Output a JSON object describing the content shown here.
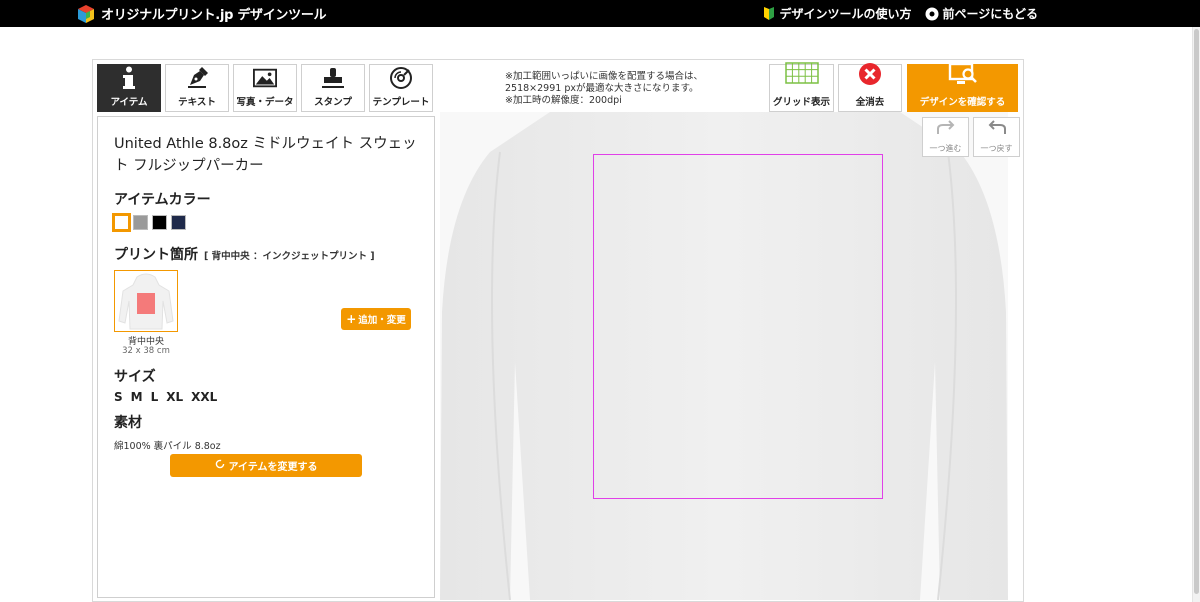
{
  "header": {
    "brand": "オリジナルプリント.jp デザインツール",
    "links": [
      {
        "label": "デザインツールの使い方",
        "icon": "beginner-leaf-icon"
      },
      {
        "label": "前ページにもどる",
        "icon": "back-circle-icon"
      }
    ]
  },
  "tabs": [
    {
      "label": "アイテム",
      "icon": "info-icon",
      "active": true
    },
    {
      "label": "テキスト",
      "icon": "pen-icon",
      "active": false
    },
    {
      "label": "写真・データ",
      "icon": "image-icon",
      "active": false
    },
    {
      "label": "スタンプ",
      "icon": "stamp-icon",
      "active": false
    },
    {
      "label": "テンプレート",
      "icon": "disc-icon",
      "active": false
    }
  ],
  "notice": {
    "line1": "※加工範囲いっぱいに画像を配置する場合は、",
    "line2": "2518×2991 pxが最適な大きさになります。",
    "line3": "※加工時の解像度：200dpi"
  },
  "actions": {
    "grid": "グリッド表示",
    "clear": "全消去",
    "confirm": "デザインを確認する",
    "redo": "一つ進む",
    "undo": "一つ戻す"
  },
  "item": {
    "title": "United Athle 8.8oz ミドルウェイト スウェット フルジップパーカー",
    "color_heading": "アイテムカラー",
    "colors": [
      "#ffffff",
      "#9a9a9a",
      "#000000",
      "#1f2a4a"
    ],
    "selected_color_index": 0,
    "print_heading": "プリント箇所",
    "print_sub": "[ 背中中央 ：インクジェットプリント ]",
    "print_location": {
      "name": "背中中央",
      "size": "32 x 38 cm"
    },
    "add_button": "追加・変更",
    "size_heading": "サイズ",
    "sizes": [
      "S",
      "M",
      "L",
      "XL",
      "XXL"
    ],
    "material_heading": "素材",
    "material": "綿100% 裏パイル 8.8oz",
    "change_button": "アイテムを変更する"
  },
  "colors": {
    "accent": "#f39800",
    "print_area_border": "#e040e8",
    "active_tab": "#2e2e2e"
  }
}
